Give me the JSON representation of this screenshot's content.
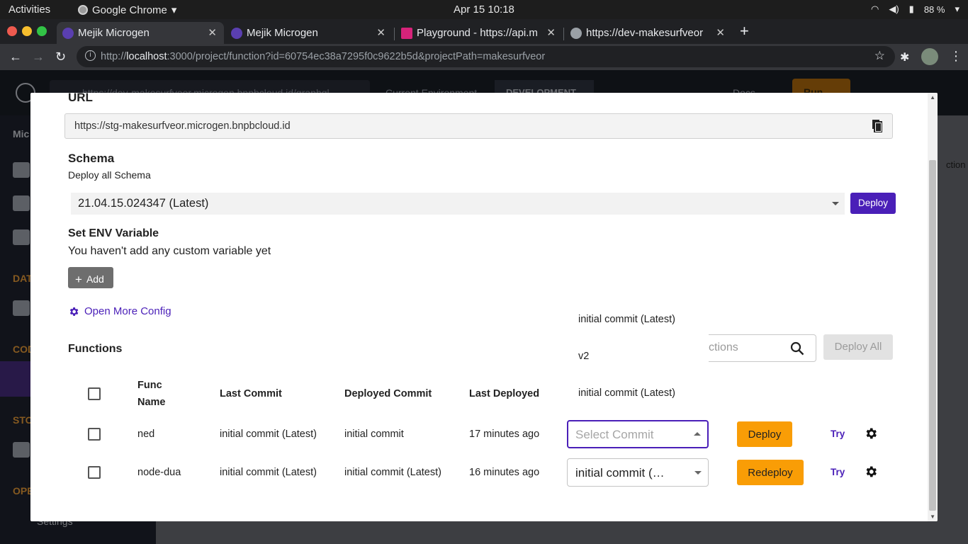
{
  "os": {
    "activities": "Activities",
    "app_name": "Google Chrome",
    "clock": "Apr 15  10:18",
    "battery": "88 %"
  },
  "tabs": [
    {
      "title": "Mejik Microgen",
      "active": true
    },
    {
      "title": "Mejik Microgen",
      "active": false
    },
    {
      "title": "Playground - https://api.m",
      "active": false
    },
    {
      "title": "https://dev-makesurfveor",
      "active": false
    }
  ],
  "address": {
    "prefix": "http://",
    "host": "localhost",
    "rest": ":3000/project/function?id=60754ec38a7295f0c9622b5d&projectPath=makesurfveor"
  },
  "background_app": {
    "url_pill": "https://dev-makesurfveor.microgen.bnpbcloud.id/graphql",
    "env_label": "Current Environment",
    "env_value": "DEVELOPMENT",
    "docs": "Docs",
    "run": "Run",
    "sidebar": {
      "mic": "Mic",
      "dat": "DAT",
      "cod": "COD",
      "sto": "STO",
      "ope": "OPE",
      "settings": "Settings"
    },
    "col_header": "ction"
  },
  "modal": {
    "url_title": "URL",
    "url_value": "https://stg-makesurfveor.microgen.bnpbcloud.id",
    "schema_title": "Schema",
    "schema_sub": "Deploy all Schema",
    "schema_selected": "21.04.15.024347 (Latest)",
    "deploy_label": "Deploy",
    "env_title": "Set ENV Variable",
    "env_empty": "You haven't add any custom variable yet",
    "add_label": "Add",
    "more_config": "Open More Config",
    "functions_title": "Functions",
    "search_placeholder": "ctions",
    "deploy_all": "Deploy All",
    "columns": {
      "func_name_1": "Func",
      "func_name_2": "Name",
      "last_commit": "Last Commit",
      "deployed_commit": "Deployed Commit",
      "last_deployed": "Last Deployed"
    },
    "rows": [
      {
        "name": "ned",
        "last_commit": "initial commit (Latest)",
        "deployed_commit": "initial commit",
        "last_deployed": "17 minutes ago",
        "commit_select": "Select Commit",
        "action": "Deploy",
        "try": "Try"
      },
      {
        "name": "node-dua",
        "last_commit": "initial commit (Latest)",
        "deployed_commit": "initial commit (Latest)",
        "last_deployed": "16 minutes ago",
        "commit_select": "initial commit (…",
        "action": "Redeploy",
        "try": "Try"
      }
    ],
    "dropdown_options": [
      "initial commit (Latest)",
      "v2",
      "initial commit (Latest)"
    ]
  },
  "colors": {
    "accent": "#4a1fb8",
    "orange": "#f99d06"
  }
}
